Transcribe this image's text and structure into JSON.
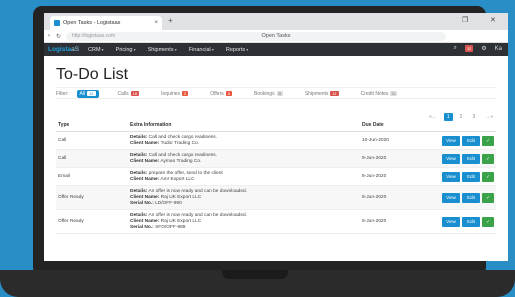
{
  "browser": {
    "tab_title": "Open Tasks - Logistaas",
    "tab_close": "×",
    "new_tab": "+",
    "url": "http://logistaas.com",
    "center_title": "Open Tasks",
    "back_icon": "‹",
    "reload_icon": "↻"
  },
  "nav": {
    "logo_main": "Logista",
    "logo_sub": "aS",
    "items": [
      "CRM",
      "Pricing",
      "Shipments",
      "Financial",
      "Reports"
    ],
    "search_icon": "🔍",
    "notif_count": "32",
    "user_short": "Ka"
  },
  "page": {
    "title": "To-Do List",
    "filter_label": "Filter:",
    "filters": [
      {
        "label": "All",
        "count": "12"
      },
      {
        "label": "Calls",
        "count": "18"
      },
      {
        "label": "Inquiries",
        "count": "2"
      },
      {
        "label": "Offers",
        "count": "8"
      },
      {
        "label": "Bookings",
        "count": "0"
      },
      {
        "label": "Shipments",
        "count": "11"
      },
      {
        "label": "Credit Notes",
        "count": "0"
      }
    ],
    "pager": {
      "prev": "«←",
      "pages": [
        "1",
        "2",
        "3"
      ],
      "next": "→»"
    },
    "columns": {
      "type": "Type",
      "info": "Extra Information",
      "due": "Due Date"
    },
    "buttons": {
      "view": "View",
      "edit": "Edit",
      "ok": "✓"
    },
    "rows": [
      {
        "type": "Call",
        "details": "Call and check cargo readiness.",
        "client": "Tudor Trading Co.",
        "serial": "",
        "due": "10-Jun-2020"
      },
      {
        "type": "Call",
        "details": "Call and check cargo readiness.",
        "client": "Ayman Trading Co.",
        "serial": "",
        "due": "9-Jun-2020"
      },
      {
        "type": "Email",
        "details": "prepare the offer, send to the client",
        "client": "Amr Export LLC",
        "serial": "",
        "due": "8-Jun-2020"
      },
      {
        "type": "Offer Ready",
        "details": "An offer is now ready and can be downloaded.",
        "client": "Raj UK Export LLC",
        "serial": "LD/OFF-990",
        "due": "8-Jun-2020"
      },
      {
        "type": "Offer Ready",
        "details": "An offer is now ready and can be downloaded.",
        "client": "Raj UK Export LLC",
        "serial": "SFO/OFF-989",
        "due": "8-Jun-2020"
      }
    ],
    "details_label": "Details:",
    "client_label": "Client Name:",
    "serial_label": "Serial No.:"
  }
}
